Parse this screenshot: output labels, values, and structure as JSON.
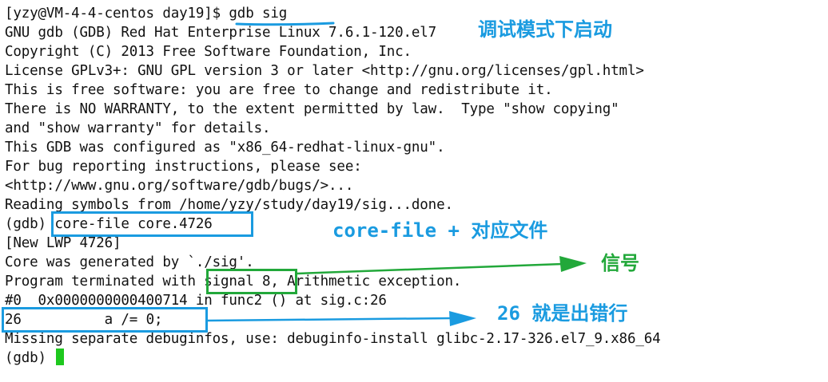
{
  "terminal": {
    "lines": [
      "[yzy@VM-4-4-centos day19]$ gdb sig",
      "GNU gdb (GDB) Red Hat Enterprise Linux 7.6.1-120.el7",
      "Copyright (C) 2013 Free Software Foundation, Inc.",
      "License GPLv3+: GNU GPL version 3 or later <http://gnu.org/licenses/gpl.html>",
      "This is free software: you are free to change and redistribute it.",
      "There is NO WARRANTY, to the extent permitted by law.  Type \"show copying\"",
      "and \"show warranty\" for details.",
      "This GDB was configured as \"x86_64-redhat-linux-gnu\".",
      "For bug reporting instructions, please see:",
      "<http://www.gnu.org/software/gdb/bugs/>...",
      "Reading symbols from /home/yzy/study/day19/sig...done.",
      "(gdb) core-file core.4726",
      "[New LWP 4726]",
      "Core was generated by `./sig'.",
      "Program terminated with signal 8, Arithmetic exception.",
      "#0  0x0000000000400714 in func2 () at sig.c:26",
      "26\t    a /= 0;",
      "Missing separate debuginfos, use: debuginfo-install glibc-2.17-326.el7_9.x86_64",
      "(gdb) "
    ]
  },
  "annotations": {
    "debug_start": "调试模式下启动",
    "core_file": "core-file + 对应文件",
    "signal": "信号",
    "error_line": "26 就是出错行"
  },
  "colors": {
    "text": "#111111",
    "blue": "#1a9be0",
    "green": "#22a83a",
    "cursor": "#1ec81e"
  }
}
